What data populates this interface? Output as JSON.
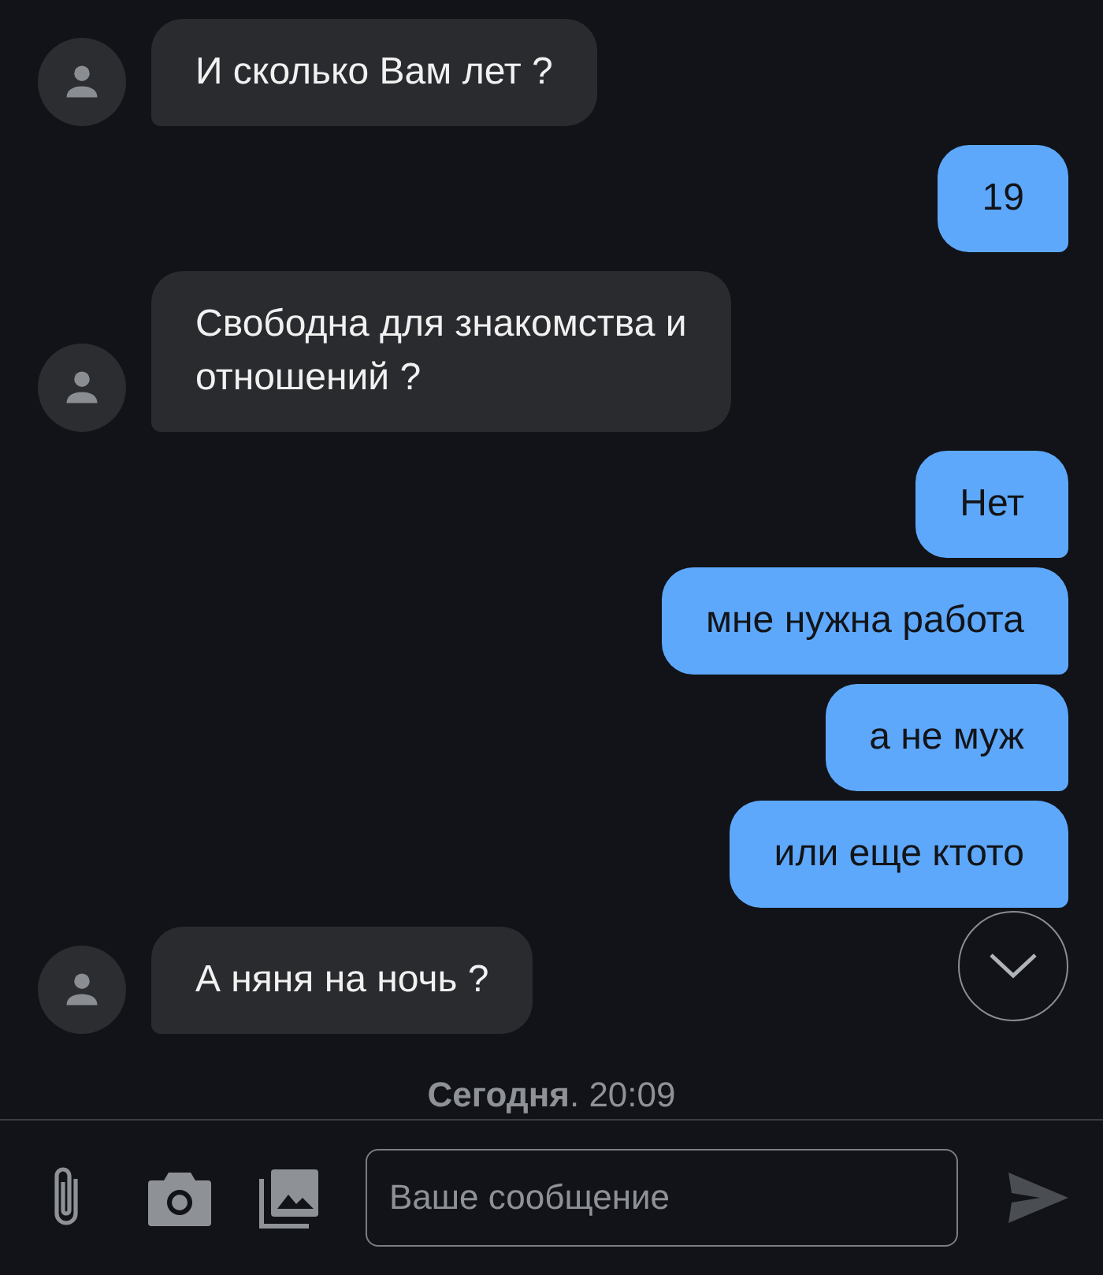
{
  "messages": [
    {
      "kind": "in",
      "text": "И сколько Вам лет ?"
    },
    {
      "kind": "out",
      "text": "19"
    },
    {
      "kind": "in",
      "text": "Свободна для знакомства и\nотношений ?"
    },
    {
      "kind": "out",
      "text": "Нет"
    },
    {
      "kind": "out",
      "text": "мне нужна работа"
    },
    {
      "kind": "out",
      "text": "а не муж"
    },
    {
      "kind": "out",
      "text": "или еще ктото"
    },
    {
      "kind": "in",
      "text": "А няня на ночь ?"
    }
  ],
  "date_separator": "**Сегодня**. 20:09",
  "composer": {
    "placeholder": "Ваше сообщение"
  }
}
